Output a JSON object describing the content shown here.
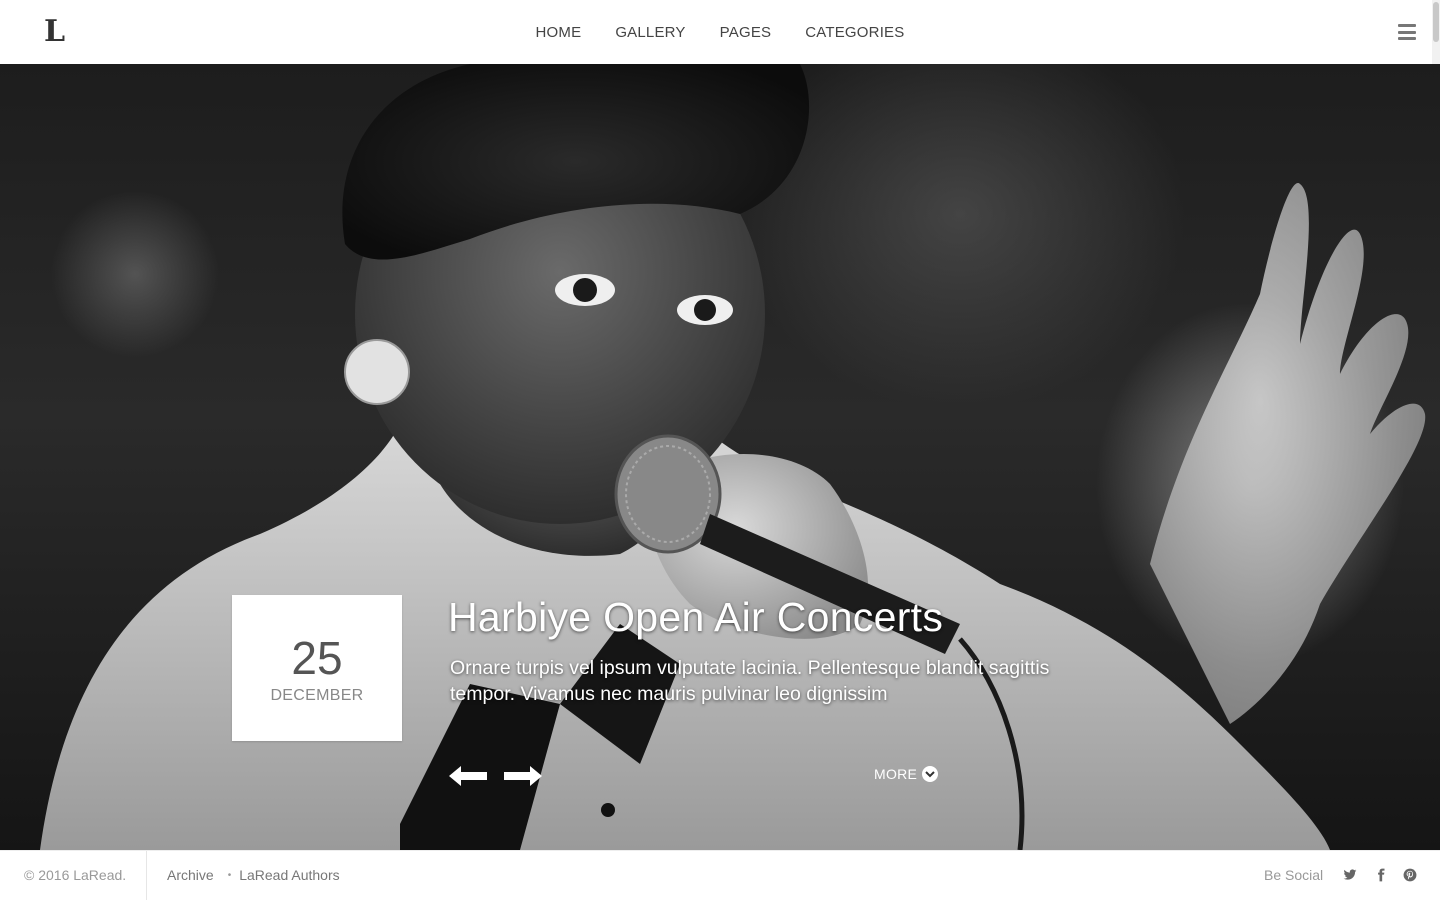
{
  "header": {
    "logo": "L",
    "nav": [
      {
        "label": "HOME"
      },
      {
        "label": "GALLERY"
      },
      {
        "label": "PAGES"
      },
      {
        "label": "CATEGORIES"
      }
    ],
    "menu_icon": "hamburger-menu-icon"
  },
  "hero": {
    "image": "black-and-white photo of a singer holding a microphone",
    "date": {
      "day": "25",
      "month": "DECEMBER"
    },
    "title": "Harbiye Open Air Concerts",
    "excerpt": "Ornare turpis vel ipsum vulputate lacinia. Pellentesque blandit sagittis tempor. Vivamus nec mauris pulvinar leo dignissim",
    "prev_icon": "arrow-left-icon",
    "next_icon": "arrow-right-icon",
    "more_label": "MORE",
    "more_icon": "chevron-down-circle-icon"
  },
  "footer": {
    "copyright": "© 2016 LaRead.",
    "links": [
      {
        "label": "Archive"
      },
      {
        "label": "LaRead Authors"
      }
    ],
    "separator": "•",
    "social_label": "Be Social",
    "social_icons": [
      "twitter-icon",
      "facebook-icon",
      "pinterest-icon"
    ]
  },
  "colors": {
    "header_bg": "#ffffff",
    "nav_text": "#444444",
    "hero_text": "#ffffff",
    "date_box_bg": "#ffffff",
    "footer_text": "#999999"
  }
}
